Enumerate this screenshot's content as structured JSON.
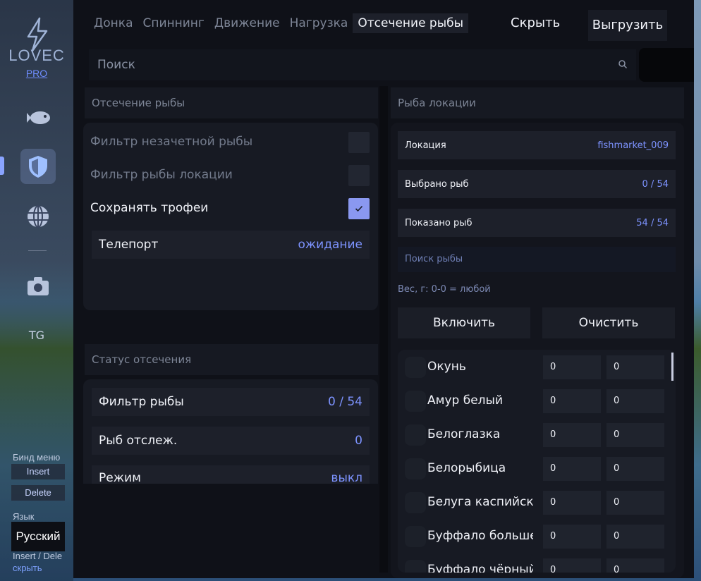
{
  "sidebar": {
    "logo_text": "LOVEC",
    "logo_pro": "PRO",
    "icons": [
      "fish-icon",
      "shield-icon",
      "globe-icon",
      "camera-icon"
    ],
    "tg": "TG",
    "bind_label": "Бинд меню",
    "bind_insert": "Insert",
    "bind_delete": "Delete",
    "lang_label": "Язык",
    "lang_value": "Русский",
    "hint": "Insert / Dele",
    "hide_link": "скрыть"
  },
  "tabs": [
    "Донка",
    "Спиннинг",
    "Движение",
    "Нагрузка",
    "Отсечение рыбы"
  ],
  "active_tab": 4,
  "header": {
    "hide": "Скрыть",
    "export": "Выгрузить"
  },
  "search": {
    "label": "Поиск"
  },
  "left": {
    "section_title": "Отсечение рыбы",
    "filter_unscored": "Фильтр незачетной рыбы",
    "filter_location": "Фильтр рыбы локации",
    "save_trophies": "Сохранять трофеи",
    "teleport_label": "Телепорт",
    "teleport_value": "ожидание",
    "status_title": "Статус отсечения",
    "status": [
      {
        "label": "Фильтр рыбы",
        "value": "0 / 54"
      },
      {
        "label": "Рыб отслеж.",
        "value": "0"
      },
      {
        "label": "Режим",
        "value": "выкл"
      }
    ]
  },
  "right": {
    "section_title": "Рыба локации",
    "location_label": "Локация",
    "location_value": "fishmarket_009",
    "selected_label": "Выбрано рыб",
    "selected_value": "0 / 54",
    "shown_label": "Показано рыб",
    "shown_value": "54 / 54",
    "fish_search": "Поиск рыбы",
    "weight_hint": "Вес, г: 0-0 = любой",
    "enable": "Включить",
    "clear": "Очистить",
    "fish": [
      {
        "name": "Окунь",
        "min": "0",
        "max": "0"
      },
      {
        "name": "Амур белый",
        "min": "0",
        "max": "0"
      },
      {
        "name": "Белоглазка",
        "min": "0",
        "max": "0"
      },
      {
        "name": "Белорыбица",
        "min": "0",
        "max": "0"
      },
      {
        "name": "Белуга каспийская",
        "min": "0",
        "max": "0"
      },
      {
        "name": "Буффало большер",
        "min": "0",
        "max": "0"
      },
      {
        "name": "Буффало чёрный",
        "min": "0",
        "max": "0"
      }
    ]
  },
  "colors": {
    "accent": "#7d93ff",
    "checkbox_on": "#8a98f0",
    "panel": "#171a23"
  }
}
